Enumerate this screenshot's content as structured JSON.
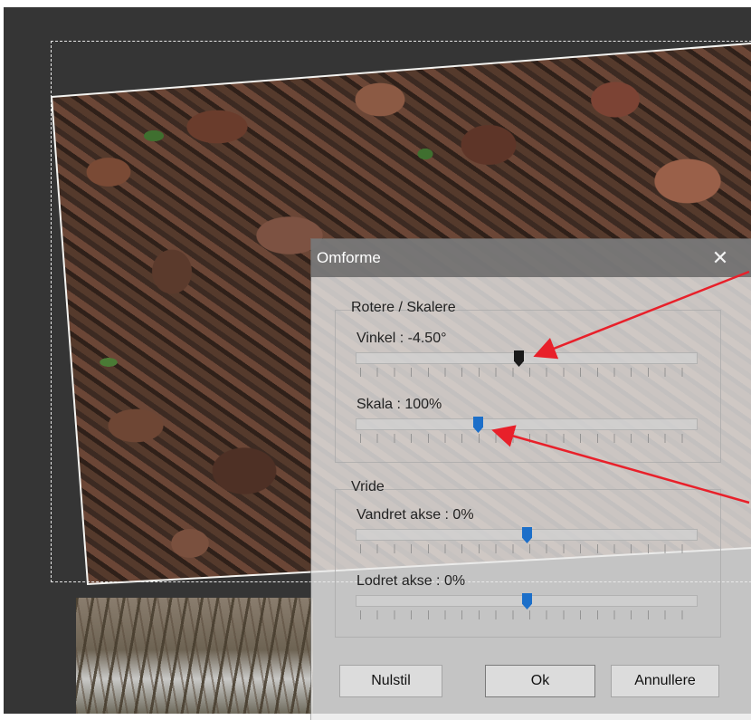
{
  "dialog": {
    "title": "Omforme",
    "close_glyph": "✕",
    "rotate_scale": {
      "title": "Rotere / Skalere",
      "angle_label": "Vinkel : -4.50°",
      "angle_value": -4.5,
      "scale_label": "Skala : 100%",
      "scale_value": 100
    },
    "skew": {
      "title": "Vride",
      "horizontal_label": "Vandret akse : 0%",
      "horizontal_value": 0,
      "vertical_label": "Lodret akse : 0%",
      "vertical_value": 0
    },
    "buttons": {
      "reset": "Nulstil",
      "ok": "Ok",
      "cancel": "Annullere"
    }
  },
  "annotations": {
    "arrow_color": "#e8202a"
  },
  "colors": {
    "canvas": "#353535",
    "slider_thumb_active": "#1a1a1a",
    "slider_thumb": "#1c6fc9"
  }
}
